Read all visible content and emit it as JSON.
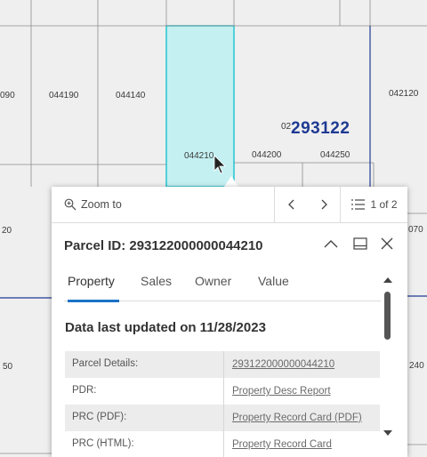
{
  "map": {
    "parcels": [
      "090",
      "044190",
      "044140",
      "044210",
      "044200",
      "044250",
      "042120",
      "20",
      "070",
      "50",
      "240"
    ],
    "section_prefix": "02",
    "section_number": "293122"
  },
  "popup": {
    "zoom_label": "Zoom to",
    "feature_count": "1 of 2",
    "title": "Parcel ID: 293122000000044210",
    "tabs": [
      "Property",
      "Sales",
      "Owner",
      "Value"
    ],
    "active_tab": "Property",
    "updated": "Data last updated on 11/28/2023",
    "rows": [
      {
        "label": "Parcel Details:",
        "value": "293122000000044210"
      },
      {
        "label": "PDR:",
        "value": "Property Desc Report"
      },
      {
        "label": "PRC (PDF):",
        "value": "Property Record Card (PDF)"
      },
      {
        "label": "PRC (HTML):",
        "value": "Property Record Card"
      }
    ]
  },
  "colors": {
    "selected_fill": "#c4f0f2",
    "selected_outline": "#25c5d1",
    "section_line": "#1f3a93",
    "tab_accent": "#1a73c8"
  },
  "icons": [
    "search-icon",
    "chevron-left-icon",
    "chevron-right-icon",
    "list-icon",
    "chevron-up-icon",
    "dock-icon",
    "close-icon",
    "cursor-icon",
    "scroll-up-icon",
    "scroll-down-icon"
  ]
}
